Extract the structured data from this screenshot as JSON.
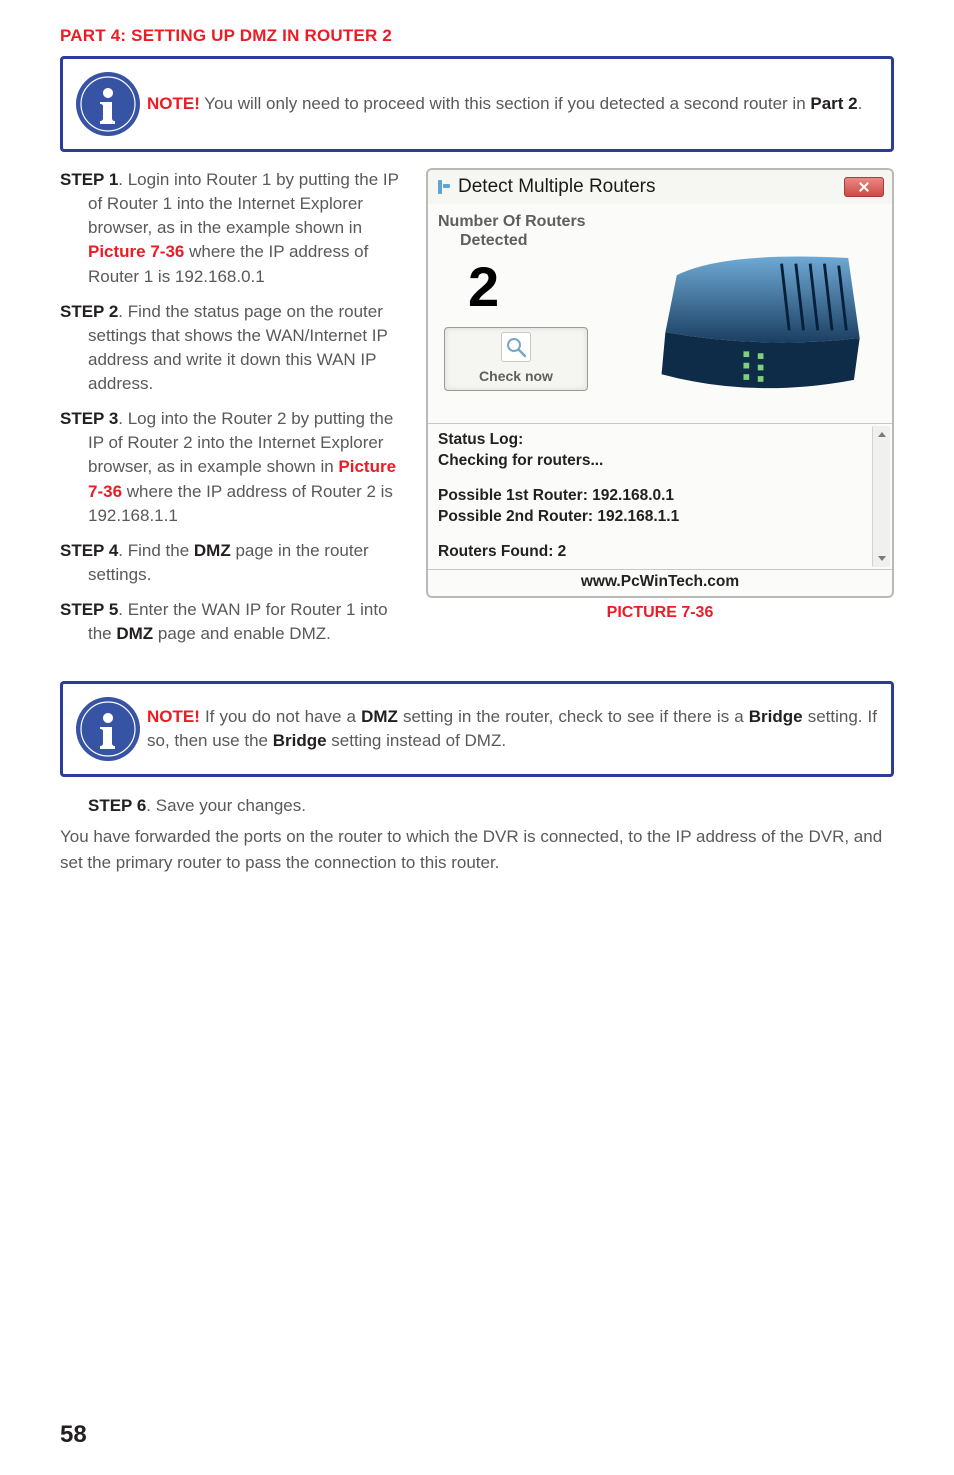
{
  "heading": "PART 4: SETTING UP DMZ IN ROUTER 2",
  "note1": {
    "label": "NOTE!",
    "text_pre": " You will only need to proceed with this section if you detected a second router in ",
    "bold": "Part 2",
    "text_post": "."
  },
  "step1": {
    "label": "STEP 1",
    "t1": ". Login into Router 1 by putting the IP of Router 1 into the Internet Explorer browser, as in the example shown in ",
    "pic": "Picture 7-36",
    "t2": " where the IP address of Router 1 is 192.168.0.1"
  },
  "step2": {
    "label": "STEP 2",
    "t1": ". Find the status page on the router settings that shows the WAN/Internet IP address and  write it down this WAN IP address."
  },
  "step3": {
    "label": "STEP 3",
    "t1": ". Log into the Router 2 by putting the IP of Router 2 into the Internet Explorer browser, as in example shown in ",
    "pic": "Picture 7-36",
    "t2": " where the IP address of Router 2 is  192.168.1.1"
  },
  "step4": {
    "label": "STEP 4",
    "t1": ". Find the ",
    "bold": "DMZ",
    "t2": " page in the router settings."
  },
  "step5": {
    "label": "STEP 5",
    "t1": ". Enter the WAN IP for Router 1 into the ",
    "bold": "DMZ",
    "t2": " page and enable DMZ."
  },
  "window": {
    "title": "Detect Multiple Routers",
    "nrd_line1": "Number Of Routers",
    "nrd_line2": "Detected",
    "count": "2",
    "checknow": "Check now",
    "status_label": "Status Log:",
    "checking": "Checking for routers...",
    "p1": "Possible 1st Router: 192.168.0.1",
    "p2": "Possible 2nd Router: 192.168.1.1",
    "found": "Routers Found: 2",
    "url": "www.PcWinTech.com"
  },
  "caption": "PICTURE 7-36",
  "note2": {
    "label": "NOTE!",
    "t1": "  If you do not have a ",
    "b1": "DMZ",
    "t2": " setting in the router, check to see if there is a ",
    "b2": "Bridge",
    "t3": " setting. If so, then use the ",
    "b3": "Bridge",
    "t4": " setting instead of DMZ."
  },
  "step6": {
    "label": "STEP 6",
    "t1": ". Save your changes."
  },
  "para": "You have forwarded the ports on the router to which the DVR is connected, to the IP address of the DVR, and set the primary router to pass the connection to this router.",
  "page": "58"
}
